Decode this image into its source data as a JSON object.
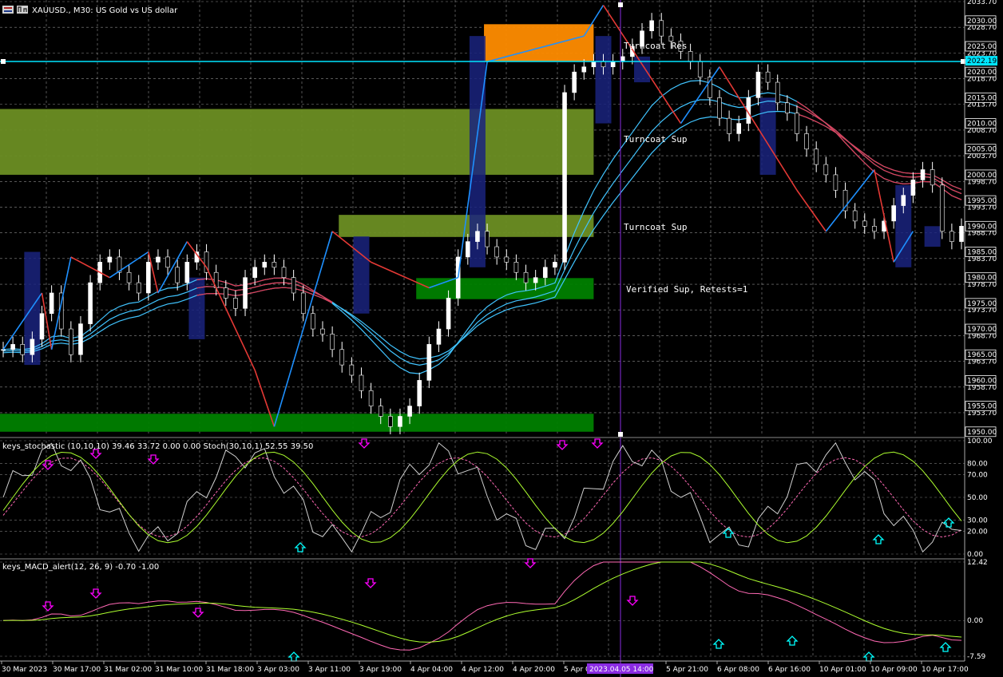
{
  "window": {
    "symbol_title": "XAUUSD., M30:  US Gold vs US dollar"
  },
  "colors": {
    "background": "#000000",
    "grid": "#c8c8c8",
    "bull_candle": "#ffffff",
    "bear_candle": "#ffffff",
    "zone_olive": "#6b8e23",
    "zone_green": "#008000",
    "zone_orange": "#ff8c00",
    "order_block": "#1a237e",
    "zigzag_up": "#1e90ff",
    "zigzag_down": "#e53935",
    "ema_blue": "#40c4ff",
    "ema_red": "#e53950",
    "hline": "#00e5ff",
    "vline": "#8a2be2",
    "stoch_main": "#ffffff",
    "stoch_signal": "#ff69b4",
    "macd_main": "#ff69b4",
    "macd_signal": "#adff2f",
    "arrow_down": "#ff00ff",
    "arrow_up": "#00ffff"
  },
  "price_axis": {
    "ticks": [
      "2033.70",
      "2028.70",
      "2023.70",
      "2018.70",
      "2013.70",
      "2008.70",
      "2003.70",
      "1998.70",
      "1993.70",
      "1988.70",
      "1983.70",
      "1978.70",
      "1973.70",
      "1968.70",
      "1963.70",
      "1958.70",
      "1953.70"
    ],
    "boxed": [
      "2030.00",
      "2025.00",
      "2020.00",
      "2015.00",
      "2010.00",
      "2005.00",
      "2000.00",
      "1995.00",
      "1990.00",
      "1985.00",
      "1980.00",
      "1975.00",
      "1970.00",
      "1965.00",
      "1960.00",
      "1955.00",
      "1950.00"
    ],
    "current_price": "2022.19"
  },
  "zone_labels": {
    "res1": "Turncoat Res",
    "sup1": "Turncoat Sup",
    "sup2": "Turncoat Sup",
    "sup3": "Verified Sup, Retests=1"
  },
  "stoch_panel": {
    "title": "keys_stochastic (10,10,10) 39.46 33.72 0.00 0.00 Stoch(30,10,1) 52.55 39.50",
    "ticks": [
      "100.00",
      "80.00",
      "70.00",
      "50.00",
      "30.00",
      "20.00",
      "0.00"
    ]
  },
  "macd_panel": {
    "title": "keys_MACD_alert(12, 26, 9) -0.70 -1.00",
    "ticks": [
      "12.42",
      "0.00",
      "-7.59"
    ]
  },
  "time_axis": {
    "labels": [
      "30 Mar 2023",
      "30 Mar 17:00",
      "31 Mar 02:00",
      "31 Mar 10:00",
      "31 Mar 18:00",
      "3 Apr 03:00",
      "3 Apr 11:00",
      "3 Apr 19:00",
      "4 Apr 04:00",
      "4 Apr 12:00",
      "4 Apr 20:00",
      "5 Apr 05:00",
      "5 Apr 21:00",
      "6 Apr 08:00",
      "6 Apr 16:00",
      "10 Apr 01:00",
      "10 Apr 09:00",
      "10 Apr 17:00"
    ],
    "cursor_label": "2023.04.05 14:00"
  },
  "chart_data": {
    "type": "candlestick",
    "symbol": "XAUUSD.",
    "timeframe": "M30",
    "ylim": [
      1949.5,
      2033.7
    ],
    "current_price": 2022.19,
    "x_count": 100,
    "cursor_index": 61,
    "closes": [
      1966,
      1967,
      1965,
      1968,
      1973,
      1977,
      1970,
      1965,
      1971,
      1979,
      1983,
      1984,
      1981,
      1979,
      1977,
      1983,
      1984,
      1982,
      1979,
      1983,
      1985,
      1981,
      1978,
      1976,
      1974,
      1980,
      1982,
      1983,
      1982,
      1980,
      1977,
      1973,
      1970,
      1969,
      1966,
      1963,
      1961,
      1958,
      1955,
      1953,
      1951,
      1953,
      1955,
      1960,
      1967,
      1970,
      1976,
      1984,
      1987,
      1989,
      1986,
      1984,
      1983,
      1981,
      1979,
      1980,
      1982,
      1983,
      2016,
      2020,
      2021,
      2022,
      2021,
      2022,
      2023,
      2025,
      2028,
      2030,
      2027,
      2026,
      2024,
      2022,
      2019,
      2015,
      2011,
      2008,
      2010,
      2015,
      2020,
      2018,
      2014,
      2012,
      2008,
      2005,
      2002,
      2000,
      1997,
      1993,
      1991,
      1990,
      1989,
      1991,
      1994,
      1996,
      1999,
      2001,
      1998,
      1989,
      1987,
      1990
    ],
    "zigzag": [
      [
        0,
        1966
      ],
      [
        4,
        1977
      ],
      [
        5,
        1966
      ],
      [
        7,
        1984
      ],
      [
        11,
        1980
      ],
      [
        15,
        1985
      ],
      [
        16,
        1977
      ],
      [
        19,
        1987
      ],
      [
        21,
        1982
      ],
      [
        26,
        1962
      ],
      [
        28,
        1951
      ],
      [
        34,
        1989
      ],
      [
        38,
        1983
      ],
      [
        44,
        1978
      ],
      [
        47,
        1980
      ],
      [
        50,
        2022
      ],
      [
        60,
        2027
      ],
      [
        62,
        2033
      ],
      [
        70,
        2010
      ],
      [
        74,
        2021
      ],
      [
        82,
        1997
      ],
      [
        85,
        1989
      ],
      [
        90,
        2001
      ],
      [
        92,
        1983
      ],
      [
        94,
        1989
      ]
    ],
    "zones": [
      {
        "label": "Turncoat Res",
        "from": 2022.1,
        "to": 2029.3,
        "color": "#ff8c00",
        "x_from": 50,
        "x_to": 61
      },
      {
        "label": "Turncoat Sup",
        "from": 2000.0,
        "to": 2012.8,
        "color": "#6b8e23",
        "x_from": 0,
        "x_to": 61
      },
      {
        "label": "Turncoat Sup",
        "from": 1987.9,
        "to": 1992.2,
        "color": "#6b8e23",
        "x_from": 35,
        "x_to": 61
      },
      {
        "label": "Verified Sup, Retests=1",
        "from": 1975.8,
        "to": 1979.9,
        "color": "#008000",
        "x_from": 43,
        "x_to": 61
      },
      {
        "label": "",
        "from": 1950.0,
        "to": 1953.5,
        "color": "#008000",
        "x_from": 0,
        "x_to": 61
      }
    ],
    "stochastic": {
      "ylim": [
        0,
        100
      ],
      "ticks": [
        100,
        80,
        70,
        50,
        30,
        20,
        0
      ]
    },
    "macd": {
      "ylim": [
        -7.59,
        12.42
      ],
      "ticks": [
        12.42,
        0,
        -7.59
      ]
    }
  }
}
